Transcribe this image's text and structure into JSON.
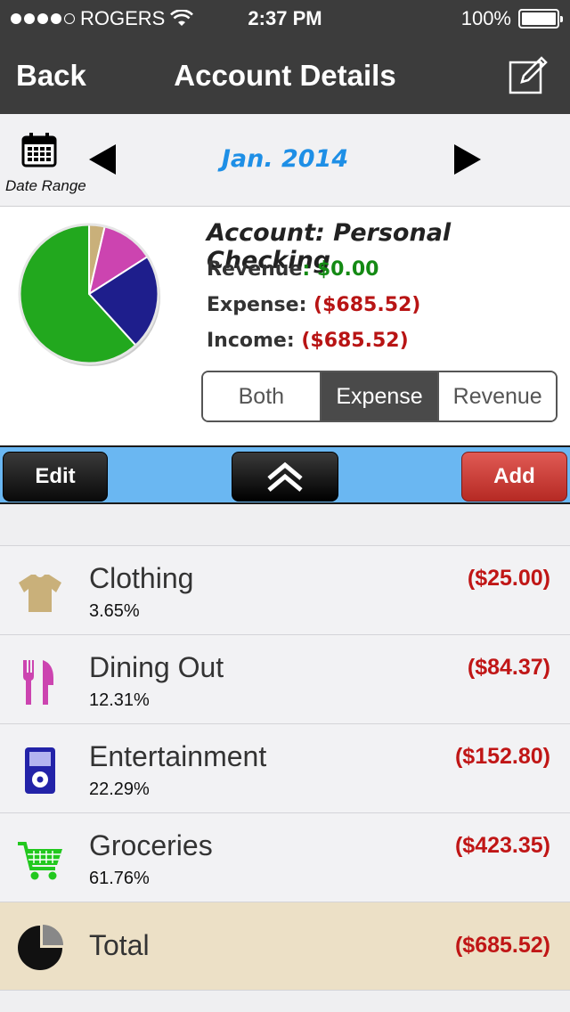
{
  "status_bar": {
    "carrier": "ROGERS",
    "time": "2:37 PM",
    "battery": "100%"
  },
  "nav": {
    "back_label": "Back",
    "title": "Account Details",
    "edit_icon": "compose-icon"
  },
  "date_range": {
    "label": "Date Range",
    "value": "Jan. 2014"
  },
  "summary": {
    "account": "Account: Personal Checking",
    "revenue_label": "Revenue",
    "revenue_value": "$0.00",
    "expense_label": "Expense:",
    "expense_value": "($685.52)",
    "income_label": "Income:",
    "income_value": "($685.52)",
    "pie_slices": [
      {
        "name": "Clothing",
        "percent": 3.65,
        "color": "#c9b07a"
      },
      {
        "name": "Dining Out",
        "percent": 12.31,
        "color": "#cc44b0"
      },
      {
        "name": "Entertainment",
        "percent": 22.29,
        "color": "#1e1e8c"
      },
      {
        "name": "Groceries",
        "percent": 61.76,
        "color": "#22a81e"
      }
    ]
  },
  "segmented": {
    "options": [
      "Both",
      "Expense",
      "Revenue"
    ],
    "selected": "Expense"
  },
  "toolbar": {
    "edit_label": "Edit",
    "add_label": "Add"
  },
  "categories": [
    {
      "name": "Clothing",
      "percent": "3.65%",
      "amount": "($25.00)",
      "icon": "shirt-icon",
      "color": "#c9b07a"
    },
    {
      "name": "Dining Out",
      "percent": "12.31%",
      "amount": "($84.37)",
      "icon": "utensils-icon",
      "color": "#cc44b0"
    },
    {
      "name": "Entertainment",
      "percent": "22.29%",
      "amount": "($152.80)",
      "icon": "music-player-icon",
      "color": "#2323a8"
    },
    {
      "name": "Groceries",
      "percent": "61.76%",
      "amount": "($423.35)",
      "icon": "shopping-cart-icon",
      "color": "#22c81e"
    }
  ],
  "total": {
    "label": "Total",
    "amount": "($685.52)"
  }
}
